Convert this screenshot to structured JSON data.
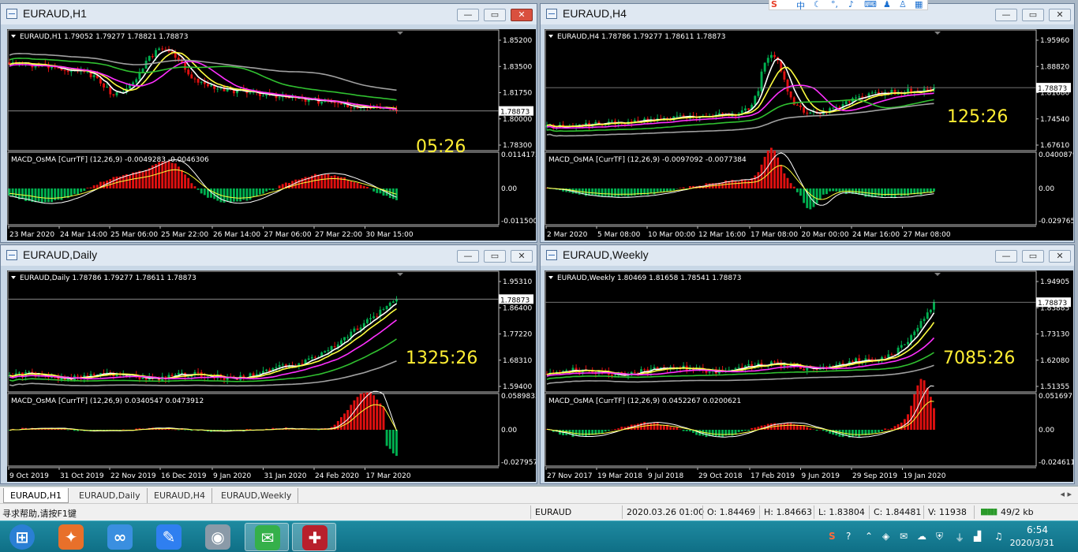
{
  "windows": [
    {
      "id": "h1",
      "title": "EURAUD,H1",
      "close_red": true,
      "info": "EURAUD,H1  1.79052 1.79277 1.78821 1.78873",
      "price_ticks": [
        "1.85200",
        "1.83500",
        "1.81750",
        "1.80000",
        "1.78300"
      ],
      "current_price": "1.78873",
      "countdown": "05:26",
      "macd_label": "MACD_OsMA [CurrTF] (12,26,9) -0.0049283 -0.0046306",
      "macd_ticks": [
        "0.0114173",
        "0.00",
        "-0.011500"
      ],
      "time_ticks": [
        "23 Mar 2020",
        "24 Mar 14:00",
        "25 Mar 06:00",
        "25 Mar 22:00",
        "26 Mar 14:00",
        "27 Mar 06:00",
        "27 Mar 22:00",
        "30 Mar 15:00"
      ]
    },
    {
      "id": "h4",
      "title": "EURAUD,H4",
      "close_red": false,
      "info": "EURAUD,H4  1.78786 1.79277 1.78611 1.78873",
      "price_ticks": [
        "1.95960",
        "1.88820",
        "1.81680",
        "1.74540",
        "1.67610"
      ],
      "current_price": "1.78873",
      "countdown": "125:26",
      "macd_label": "MACD_OsMA [CurrTF] (12,26,9) -0.0097092 -0.0077384",
      "macd_ticks": [
        "0.0400879",
        "0.00",
        "-0.029765"
      ],
      "time_ticks": [
        "2 Mar 2020",
        "5 Mar 08:00",
        "10 Mar 00:00",
        "12 Mar 16:00",
        "17 Mar 08:00",
        "20 Mar 00:00",
        "24 Mar 16:00",
        "27 Mar 08:00"
      ]
    },
    {
      "id": "d1",
      "title": "EURAUD,Daily",
      "close_red": false,
      "info": "EURAUD,Daily  1.78786 1.79277 1.78611 1.78873",
      "price_ticks": [
        "1.95310",
        "1.86400",
        "1.77220",
        "1.68310",
        "1.59400"
      ],
      "current_price": "1.78873",
      "countdown": "1325:26",
      "macd_label": "MACD_OsMA [CurrTF] (12,26,9) 0.0340547 0.0473912",
      "macd_ticks": [
        "0.0589833",
        "0.00",
        "-0.027957"
      ],
      "time_ticks": [
        "9 Oct 2019",
        "31 Oct 2019",
        "22 Nov 2019",
        "16 Dec 2019",
        "9 Jan 2020",
        "31 Jan 2020",
        "24 Feb 2020",
        "17 Mar 2020"
      ]
    },
    {
      "id": "w1",
      "title": "EURAUD,Weekly",
      "close_red": false,
      "info": "EURAUD,Weekly  1.80469 1.81658 1.78541 1.78873",
      "price_ticks": [
        "1.94905",
        "1.83885",
        "1.73130",
        "1.62080",
        "1.51355"
      ],
      "current_price": "1.78873",
      "countdown": "7085:26",
      "macd_label": "MACD_OsMA [CurrTF] (12,26,9) 0.0452267 0.0200621",
      "macd_ticks": [
        "0.0516971",
        "0.00",
        "-0.024611"
      ],
      "time_ticks": [
        "27 Nov 2017",
        "19 Mar 2018",
        "9 Jul 2018",
        "29 Oct 2018",
        "17 Feb 2019",
        "9 Jun 2019",
        "29 Sep 2019",
        "19 Jan 2020"
      ]
    }
  ],
  "tabs": [
    "EURAUD,H1",
    "EURAUD,Daily",
    "EURAUD,H4",
    "EURAUD,Weekly"
  ],
  "tab_nav": "◂ ▸",
  "status": {
    "help": "寻求帮助,请按F1键",
    "symbol": "EURAUD",
    "datetime": "2020.03.26 01:00",
    "open": "O: 1.84469",
    "high": "H: 1.84663",
    "low": "L: 1.83804",
    "close": "C: 1.84481",
    "volume": "V: 11938",
    "traffic": "49/2 kb"
  },
  "taskbar": {
    "time": "6:54",
    "date": "2020/3/31",
    "apps": [
      {
        "name": "start-button",
        "glyph": "⊞",
        "color": "#2a7fd4"
      },
      {
        "name": "app-orange",
        "glyph": "✦",
        "color": "#e8702a"
      },
      {
        "name": "app-baidu-netdisk",
        "glyph": "∞",
        "color": "#3a8fe0"
      },
      {
        "name": "app-feishu",
        "glyph": "✎",
        "color": "#2f7ff0"
      },
      {
        "name": "app-camera",
        "glyph": "◉",
        "color": "#8a9aa8"
      },
      {
        "name": "app-wechat",
        "glyph": "✉",
        "color": "#35b04a"
      },
      {
        "name": "app-metatrader",
        "glyph": "✚",
        "color": "#b8202c"
      }
    ]
  },
  "colors": {
    "bull": "#00b050",
    "bear": "#e01010",
    "price_line": "#ffffff",
    "ma_yellow": "#ffff40",
    "ma_magenta": "#ff30ff",
    "ma_green": "#30c030",
    "ma_gray": "#a0a0a0",
    "countdown": "#ffee33"
  }
}
